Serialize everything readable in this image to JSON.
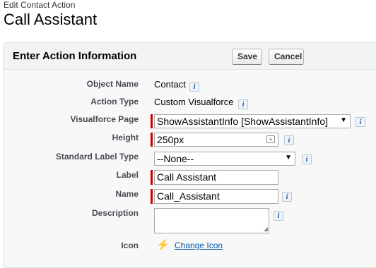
{
  "header": {
    "breadcrumb": "Edit Contact Action",
    "title": "Call Assistant"
  },
  "panel": {
    "title": "Enter Action Information",
    "save_label": "Save",
    "cancel_label": "Cancel"
  },
  "fields": {
    "object_name": {
      "label": "Object Name",
      "value": "Contact"
    },
    "action_type": {
      "label": "Action Type",
      "value": "Custom Visualforce"
    },
    "visualforce_page": {
      "label": "Visualforce Page",
      "value": "ShowAssistantInfo [ShowAssistantInfo]"
    },
    "height": {
      "label": "Height",
      "value": "250px"
    },
    "standard_label_type": {
      "label": "Standard Label Type",
      "value": "--None--"
    },
    "label": {
      "label": "Label",
      "value": "Call Assistant"
    },
    "name": {
      "label": "Name",
      "value": "Call_Assistant"
    },
    "description": {
      "label": "Description",
      "value": ""
    },
    "icon": {
      "label": "Icon",
      "link_text": "Change Icon"
    }
  },
  "icons": {
    "info": "i",
    "bolt": "⚡",
    "dropdown_caret": "▼"
  },
  "colors": {
    "required_bar": "#cc0000",
    "link": "#015ba7"
  }
}
